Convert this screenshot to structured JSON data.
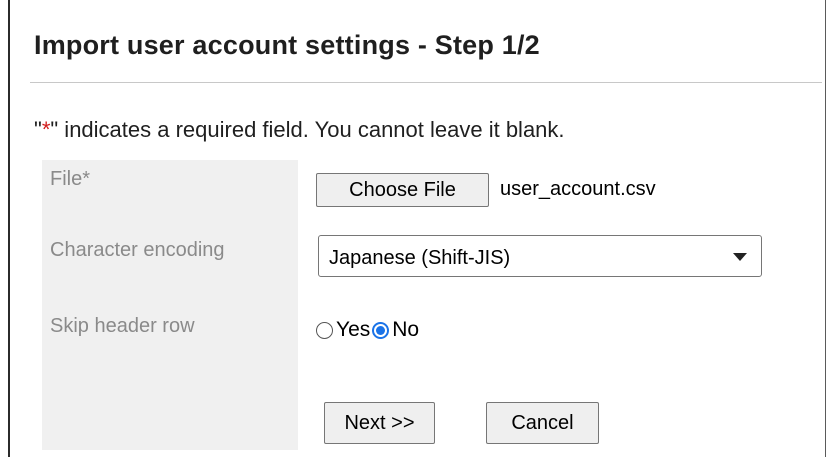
{
  "page": {
    "title": "Import user account settings - Step 1/2",
    "required_note": {
      "quote_open": "\"",
      "star": "*",
      "quote_close": "\"",
      "text": " indicates a required field. You cannot leave it blank."
    }
  },
  "form": {
    "file": {
      "label": "File",
      "required_mark": "*",
      "button_label": "Choose File",
      "selected_file": "user_account.csv"
    },
    "encoding": {
      "label": "Character encoding",
      "selected_value": "Japanese (Shift-JIS)"
    },
    "skip_header": {
      "label": "Skip header row",
      "options": [
        {
          "label": "Yes",
          "checked": false
        },
        {
          "label": "No",
          "checked": true
        }
      ]
    }
  },
  "actions": {
    "next_label": "Next >>",
    "cancel_label": "Cancel"
  },
  "colors": {
    "required_star": "#d21a1a",
    "radio_accent": "#1a73e8",
    "label_background": "#f0f0f0"
  },
  "icons": {
    "dropdown": "chevron-down-icon"
  }
}
